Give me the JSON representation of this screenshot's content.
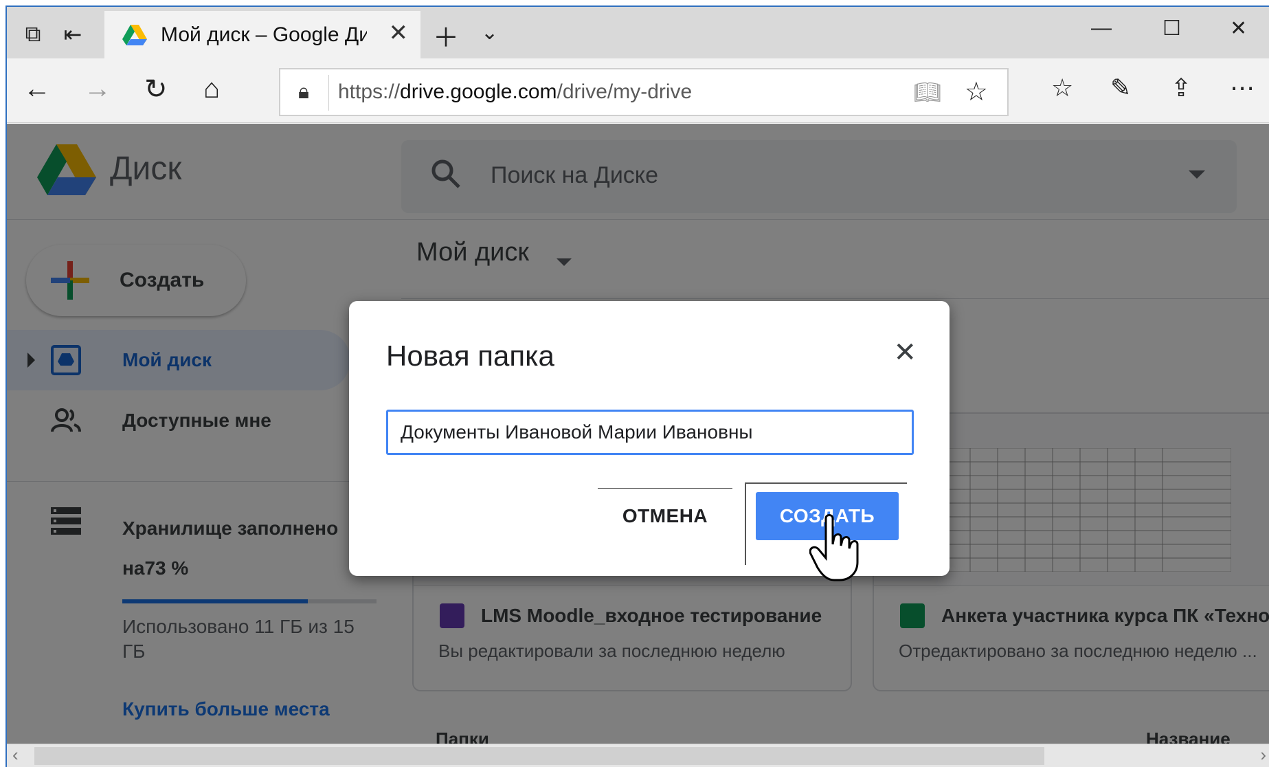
{
  "browser": {
    "tab_title": "Мой диск – Google Ди",
    "url_prefix": "https://",
    "url_host": "drive.google.com",
    "url_path": "/drive/my-drive"
  },
  "header": {
    "brand": "Диск",
    "search_placeholder": "Поиск на Диске"
  },
  "sidebar": {
    "create_label": "Создать",
    "items": [
      {
        "label": "Мой диск",
        "active": true
      },
      {
        "label": "Доступные мне",
        "active": false
      }
    ],
    "storage": {
      "line1": "Хранилище заполнено",
      "line2": "на73 %",
      "percent": 73,
      "used": "Использовано 11 ГБ из 15 ГБ",
      "buy_label": "Купить больше места"
    }
  },
  "main": {
    "title": "Мой диск",
    "cards": [
      {
        "title": "LMS Moodle_входное тестирование",
        "subtitle": "Вы редактировали за последнюю неделю",
        "icon": "forms-icon",
        "color": "#673ab7"
      },
      {
        "title": "Анкета участника курса ПК «Техно...",
        "subtitle": "Отредактировано за последнюю неделю ...",
        "icon": "sheets-icon",
        "color": "#0f9d58"
      }
    ],
    "folders_label": "Папки",
    "name_label": "Название"
  },
  "dialog": {
    "title": "Новая папка",
    "input_value": "Документы Ивановой Марии Ивановны",
    "cancel_label": "ОТМЕНА",
    "create_label": "СОЗДАТЬ"
  },
  "colors": {
    "accent": "#4285f4",
    "link": "#1a73e8",
    "active_nav_bg": "#e8f0fe"
  }
}
